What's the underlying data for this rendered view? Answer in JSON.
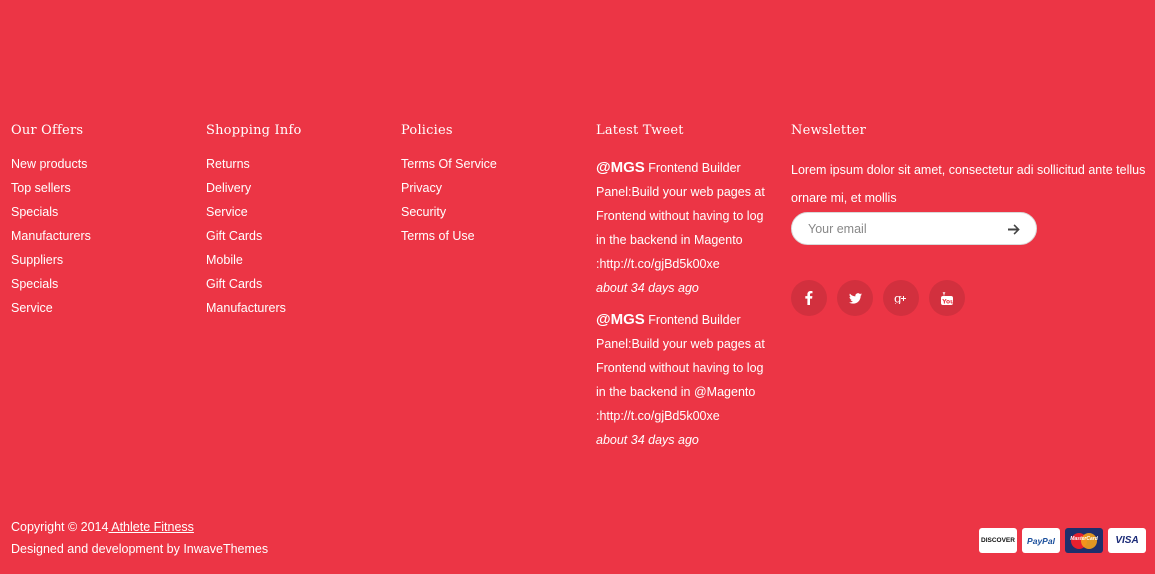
{
  "columns": {
    "offers": {
      "title": "Our Offers",
      "items": [
        "New products",
        "Top sellers",
        "Specials",
        "Manufacturers",
        "Suppliers",
        "Specials",
        "Service"
      ]
    },
    "shopping": {
      "title": "Shopping Info",
      "items": [
        "Returns",
        "Delivery",
        "Service",
        "Gift Cards",
        "Mobile",
        "Gift Cards",
        "Manufacturers"
      ]
    },
    "policies": {
      "title": "Policies",
      "items": [
        "Terms Of Service",
        "Privacy",
        "Security",
        "Terms of Use"
      ]
    },
    "tweets": {
      "title": "Latest Tweet",
      "list": [
        {
          "handle": "@MGS",
          "text": " Frontend Builder Panel:Build your web pages at Frontend without having to log in the backend in Magento :http://t.co/gjBd5k00xe",
          "time": "about 34 days ago"
        },
        {
          "handle": "@MGS",
          "text": " Frontend Builder Panel:Build your web pages at Frontend without having to log in the backend in @Magento :http://t.co/gjBd5k00xe",
          "time": "about 34 days ago"
        }
      ]
    },
    "newsletter": {
      "title": "Newsletter",
      "text": "Lorem ipsum dolor sit amet, consectetur adi sollicitud ante tellus ornare mi, et mollis",
      "email_placeholder": "Your email",
      "email_value": ""
    }
  },
  "social": [
    "facebook-icon",
    "twitter-icon",
    "google-plus-icon",
    "youtube-icon"
  ],
  "footer": {
    "copyright": "Copyright © 2014",
    "company_link": " Athlete Fitness",
    "designed": "Designed and development by InwaveThemes"
  },
  "payments": {
    "discover": "DISCOVER",
    "paypal": "PayPal",
    "mastercard": "MasterCard",
    "visa": "VISA"
  },
  "colors": {
    "background": "#ec3545",
    "text": "#ffffff"
  }
}
